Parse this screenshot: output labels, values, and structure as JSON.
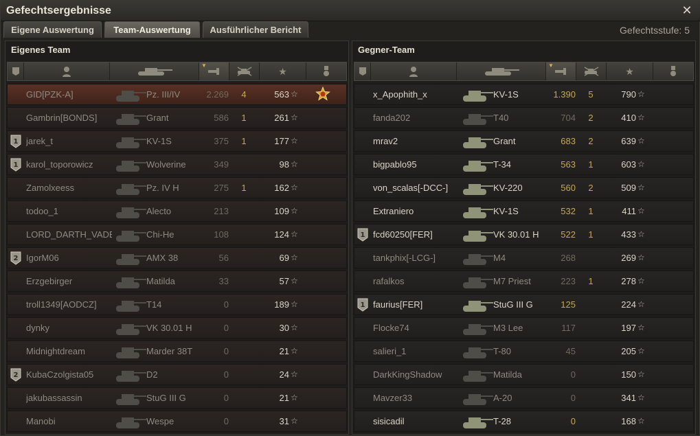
{
  "window": {
    "title": "Gefechtsergebnisse",
    "close_icon": "close-icon"
  },
  "tabs": [
    {
      "label": "Eigene Auswertung",
      "active": false
    },
    {
      "label": "Team-Auswertung",
      "active": true
    },
    {
      "label": "Ausführlicher Bericht",
      "active": false
    }
  ],
  "battle_level": "Gefechtsstufe: 5",
  "left_team": {
    "title": "Eigenes Team",
    "rows": [
      {
        "badge": "",
        "name": "GID[PZK-A]",
        "tank": "Pz. III/IV",
        "damage": "2.269",
        "kills": "4",
        "xp": "563",
        "alive": false,
        "mine": true,
        "medal": "medal-icon"
      },
      {
        "badge": "",
        "name": "Gambrin[BONDS]",
        "tank": "Grant",
        "damage": "586",
        "kills": "1",
        "xp": "261",
        "alive": false
      },
      {
        "badge": "1",
        "name": "jarek_t",
        "tank": "KV-1S",
        "damage": "375",
        "kills": "1",
        "xp": "177",
        "alive": false
      },
      {
        "badge": "1",
        "name": "karol_toporowicz",
        "tank": "Wolverine",
        "damage": "349",
        "kills": "",
        "xp": "98",
        "alive": false
      },
      {
        "badge": "",
        "name": "Zamolxeess",
        "tank": "Pz. IV H",
        "damage": "275",
        "kills": "1",
        "xp": "162",
        "alive": false
      },
      {
        "badge": "",
        "name": "todoo_1",
        "tank": "Alecto",
        "damage": "213",
        "kills": "",
        "xp": "109",
        "alive": false
      },
      {
        "badge": "",
        "name": "LORD_DARTH_VADE..",
        "tank": "Chi-He",
        "damage": "108",
        "kills": "",
        "xp": "124",
        "alive": false
      },
      {
        "badge": "2",
        "name": "IgorM06",
        "tank": "AMX 38",
        "damage": "56",
        "kills": "",
        "xp": "69",
        "alive": false
      },
      {
        "badge": "",
        "name": "Erzgebirger",
        "tank": "Matilda",
        "damage": "33",
        "kills": "",
        "xp": "57",
        "alive": false
      },
      {
        "badge": "",
        "name": "troll1349[AODCZ]",
        "tank": "T14",
        "damage": "0",
        "kills": "",
        "xp": "189",
        "alive": false
      },
      {
        "badge": "",
        "name": "dynky",
        "tank": "VK 30.01 H",
        "damage": "0",
        "kills": "",
        "xp": "30",
        "alive": false
      },
      {
        "badge": "",
        "name": "Midnightdream",
        "tank": "Marder 38T",
        "damage": "0",
        "kills": "",
        "xp": "21",
        "alive": false
      },
      {
        "badge": "2",
        "name": "KubaCzolgista05",
        "tank": "D2",
        "damage": "0",
        "kills": "",
        "xp": "24",
        "alive": false
      },
      {
        "badge": "",
        "name": "jakubassassin",
        "tank": "StuG III G",
        "damage": "0",
        "kills": "",
        "xp": "21",
        "alive": false
      },
      {
        "badge": "",
        "name": "Manobi",
        "tank": "Wespe",
        "damage": "0",
        "kills": "",
        "xp": "31",
        "alive": false
      }
    ]
  },
  "right_team": {
    "title": "Gegner-Team",
    "rows": [
      {
        "badge": "",
        "name": "x_Apophith_x",
        "tank": "KV-1S",
        "damage": "1.390",
        "kills": "5",
        "xp": "790",
        "alive": true
      },
      {
        "badge": "",
        "name": "fanda202",
        "tank": "T40",
        "damage": "704",
        "kills": "2",
        "xp": "410",
        "alive": false
      },
      {
        "badge": "",
        "name": "mrav2",
        "tank": "Grant",
        "damage": "683",
        "kills": "2",
        "xp": "639",
        "alive": true
      },
      {
        "badge": "",
        "name": "bigpablo95",
        "tank": "T-34",
        "damage": "563",
        "kills": "1",
        "xp": "603",
        "alive": true
      },
      {
        "badge": "",
        "name": "von_scalas[-DCC-]",
        "tank": "KV-220",
        "damage": "560",
        "kills": "2",
        "xp": "509",
        "alive": true
      },
      {
        "badge": "",
        "name": "Extraniero",
        "tank": "KV-1S",
        "damage": "532",
        "kills": "1",
        "xp": "411",
        "alive": true
      },
      {
        "badge": "1",
        "name": "fcd60250[FER]",
        "tank": "VK 30.01 H",
        "damage": "522",
        "kills": "1",
        "xp": "433",
        "alive": true
      },
      {
        "badge": "",
        "name": "tankphix[-LCG-]",
        "tank": "M4",
        "damage": "268",
        "kills": "",
        "xp": "269",
        "alive": false
      },
      {
        "badge": "",
        "name": "rafalkos",
        "tank": "M7 Priest",
        "damage": "223",
        "kills": "1",
        "xp": "278",
        "alive": false
      },
      {
        "badge": "1",
        "name": "faurius[FER]",
        "tank": "StuG III G",
        "damage": "125",
        "kills": "",
        "xp": "224",
        "alive": true
      },
      {
        "badge": "",
        "name": "Flocke74",
        "tank": "M3 Lee",
        "damage": "117",
        "kills": "",
        "xp": "197",
        "alive": false
      },
      {
        "badge": "",
        "name": "salieri_1",
        "tank": "T-80",
        "damage": "45",
        "kills": "",
        "xp": "205",
        "alive": false
      },
      {
        "badge": "",
        "name": "DarkKingShadow",
        "tank": "Matilda",
        "damage": "0",
        "kills": "",
        "xp": "150",
        "alive": false
      },
      {
        "badge": "",
        "name": "Mavzer33",
        "tank": "A-20",
        "damage": "0",
        "kills": "",
        "xp": "341",
        "alive": false
      },
      {
        "badge": "",
        "name": "sisicadil",
        "tank": "T-28",
        "damage": "0",
        "kills": "",
        "xp": "168",
        "alive": true
      }
    ]
  },
  "header_icons": [
    "badge-column-icon",
    "player-column-icon",
    "tank-column-icon",
    "damage-column-icon",
    "kills-column-icon",
    "xp-column-icon",
    "medal-column-icon"
  ],
  "star_symbol": "☆",
  "colors": {
    "accent": "#c7a94a",
    "own_row": "#5a3024",
    "text_alive": "#d9d5c7",
    "text_dead": "#8e8a80"
  }
}
